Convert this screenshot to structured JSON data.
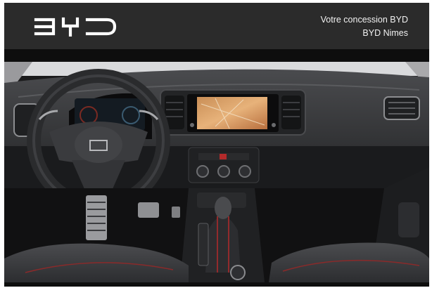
{
  "header": {
    "brand": "BYD",
    "dealer_line1": "Votre concession BYD",
    "dealer_line2": "BYD Nimes"
  },
  "photo": {
    "subject": "car-interior-dashboard"
  },
  "colors": {
    "header_bg": "#2b2b2b",
    "header_text": "#f2f2f2",
    "frame_bg": "#0e0e0e"
  }
}
